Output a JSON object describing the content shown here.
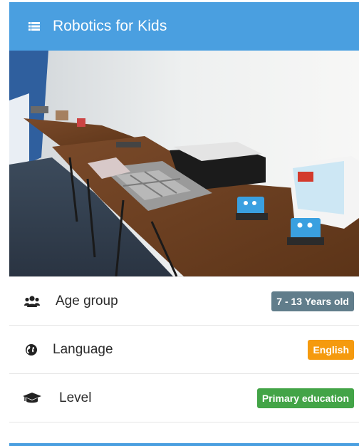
{
  "header": {
    "title": "Robotics for Kids",
    "icon": "list-icon"
  },
  "colors": {
    "header": "#4a9fe0",
    "age_badge": "#617d8b",
    "language_badge": "#f59a0e",
    "level_badge": "#43a447"
  },
  "details": [
    {
      "label": "Age group",
      "value": "7 - 13 Years old",
      "icon": "users-icon"
    },
    {
      "label": "Language",
      "value": "English",
      "icon": "globe-icon"
    },
    {
      "label": "Level",
      "value": "Primary education",
      "icon": "graduation-cap-icon"
    }
  ]
}
